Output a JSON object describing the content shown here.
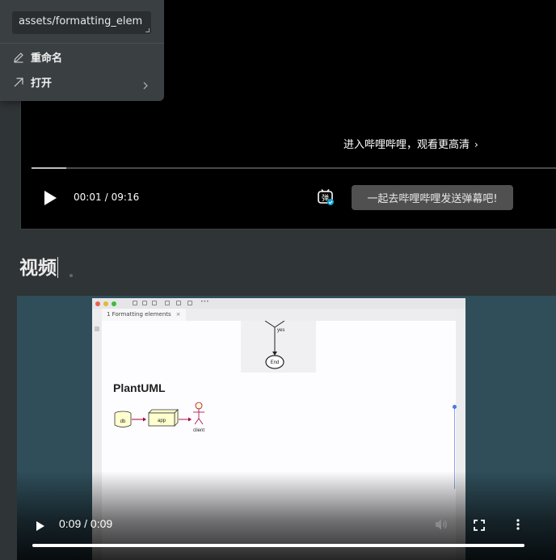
{
  "popup": {
    "path_value": "assets/formatting_elem",
    "items": [
      {
        "label": "重命名",
        "icon": "pencil-icon"
      },
      {
        "label": "打开",
        "icon": "arrow-up-right-icon",
        "submenu_icon": "chevron-right-icon"
      }
    ]
  },
  "bili_player": {
    "link_text": "进入哔哩哔哩，观看更高清",
    "current_time": "00:01",
    "separator": "/",
    "duration": "09:16",
    "progress": 0.066,
    "danmaku_toggle_label": "弹",
    "danmaku_button": "一起去哔哩哔哩发送弹幕吧!"
  },
  "heading": {
    "text": "视频"
  },
  "video": {
    "time_display": "0:09 / 0:09",
    "progress": 1.0,
    "screenshot": {
      "tab_label": "1 Formatting elements",
      "flow_yes_label": "yes",
      "flow_end_label": "End",
      "section_title": "PlantUML",
      "uml_db": "db",
      "uml_app": "app",
      "uml_client": "client"
    }
  },
  "colors": {
    "page_bg": "#2f3437",
    "video_bg": "#2f4e5a",
    "popup_bg": "#3a3f42"
  }
}
